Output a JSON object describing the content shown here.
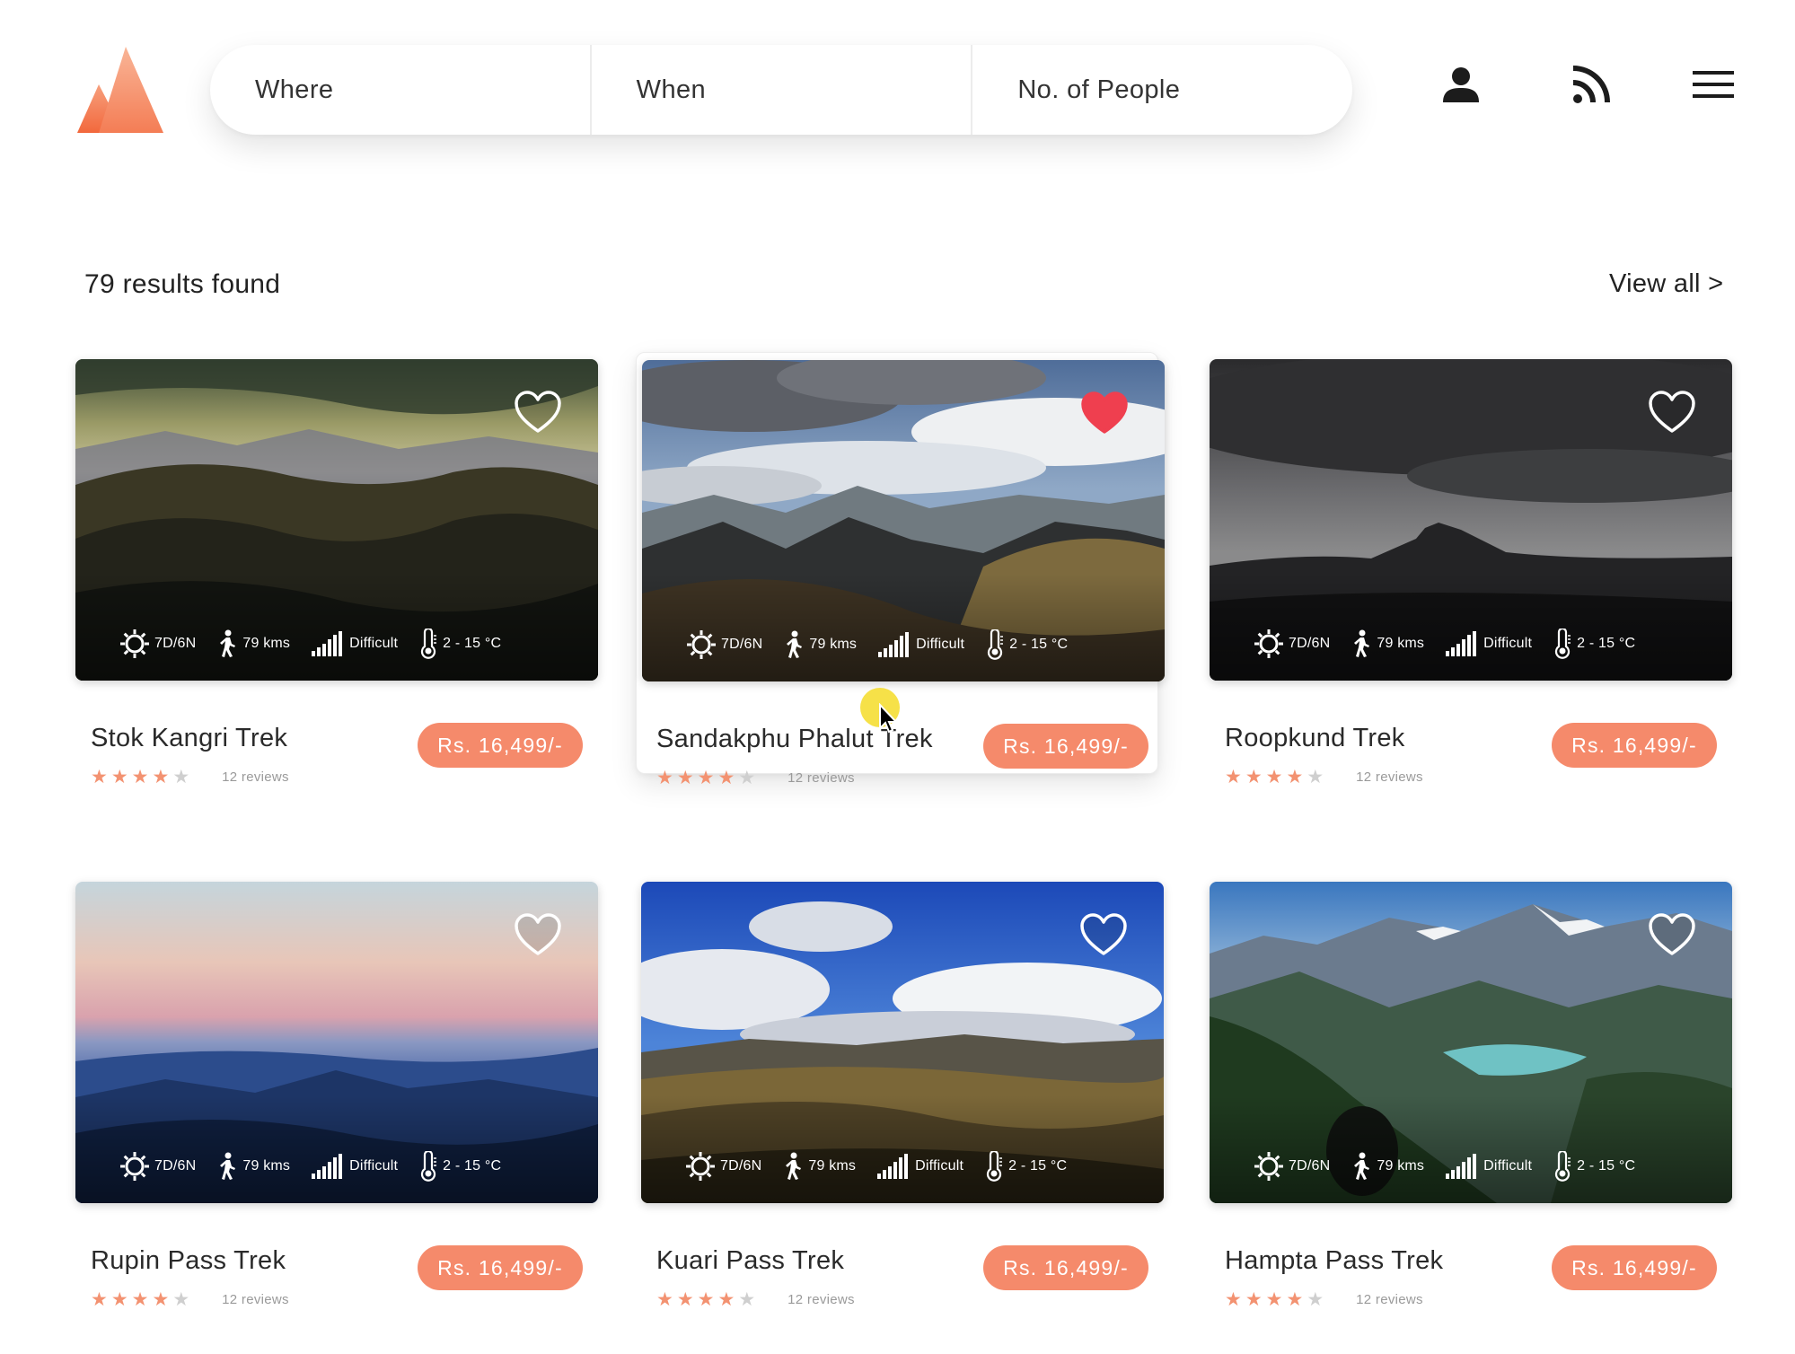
{
  "header": {
    "search": {
      "where": "Where",
      "when": "When",
      "people": "No. of People"
    },
    "icons": [
      "user-icon",
      "rss-icon",
      "menu-icon"
    ]
  },
  "results": {
    "count_label": "79 results found",
    "view_all": "View all >"
  },
  "colors": {
    "accent": "#f58a6b",
    "heart_active": "#ef3f4f",
    "star": "#f39271"
  },
  "cards": [
    {
      "title": "Stok Kangri Trek",
      "price": "Rs. 16,499/-",
      "rating": 4,
      "reviews": "12 reviews",
      "favorite": false,
      "duration": "7D/6N",
      "distance": "79 kms",
      "difficulty": "Difficult",
      "temperature": "2 - 15 °C"
    },
    {
      "title": "Sandakphu Phalut Trek",
      "price": "Rs. 16,499/-",
      "rating": 4,
      "reviews": "12 reviews",
      "favorite": true,
      "duration": "7D/6N",
      "distance": "79 kms",
      "difficulty": "Difficult",
      "temperature": "2 - 15 °C"
    },
    {
      "title": "Roopkund Trek",
      "price": "Rs. 16,499/-",
      "rating": 4,
      "reviews": "12 reviews",
      "favorite": false,
      "duration": "7D/6N",
      "distance": "79 kms",
      "difficulty": "Difficult",
      "temperature": "2 - 15 °C"
    },
    {
      "title": "Rupin Pass Trek",
      "price": "Rs. 16,499/-",
      "rating": 4,
      "reviews": "12 reviews",
      "favorite": false,
      "duration": "7D/6N",
      "distance": "79 kms",
      "difficulty": "Difficult",
      "temperature": "2 - 15 °C"
    },
    {
      "title": "Kuari Pass Trek",
      "price": "Rs. 16,499/-",
      "rating": 4,
      "reviews": "12 reviews",
      "favorite": false,
      "duration": "7D/6N",
      "distance": "79 kms",
      "difficulty": "Difficult",
      "temperature": "2 - 15 °C"
    },
    {
      "title": "Hampta Pass Trek",
      "price": "Rs. 16,499/-",
      "rating": 4,
      "reviews": "12 reviews",
      "favorite": false,
      "duration": "7D/6N",
      "distance": "79 kms",
      "difficulty": "Difficult",
      "temperature": "2 - 15 °C"
    }
  ]
}
